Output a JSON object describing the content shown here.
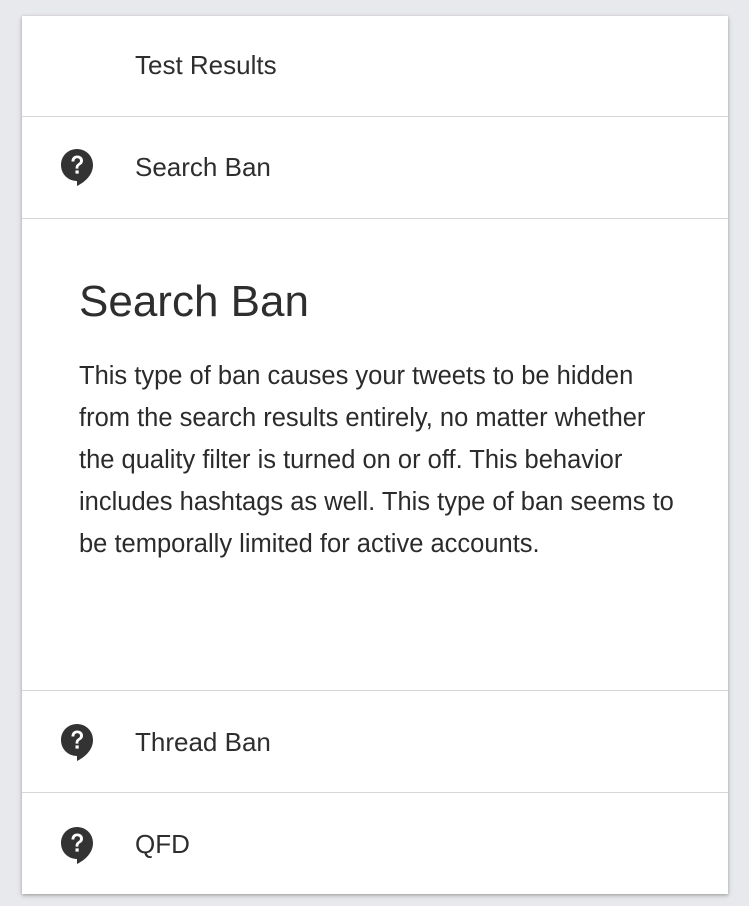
{
  "panel": {
    "header_label": "Test Results",
    "items": [
      {
        "label": "Search Ban",
        "icon": "help-icon"
      },
      {
        "label": "Thread Ban",
        "icon": "help-icon"
      },
      {
        "label": "QFD",
        "icon": "help-icon"
      }
    ],
    "detail": {
      "title": "Search Ban",
      "body": "This type of ban causes your tweets to be hidden from the search results entirely, no matter whether the quality filter is turned on or off. This behavior includes hashtags as well. This type of ban seems to be temporally limited for active accounts."
    }
  },
  "colors": {
    "background": "#e8e9ec",
    "card": "#ffffff",
    "divider": "#d7d7d7",
    "icon": "#333333",
    "text": "#2e2e2e"
  }
}
